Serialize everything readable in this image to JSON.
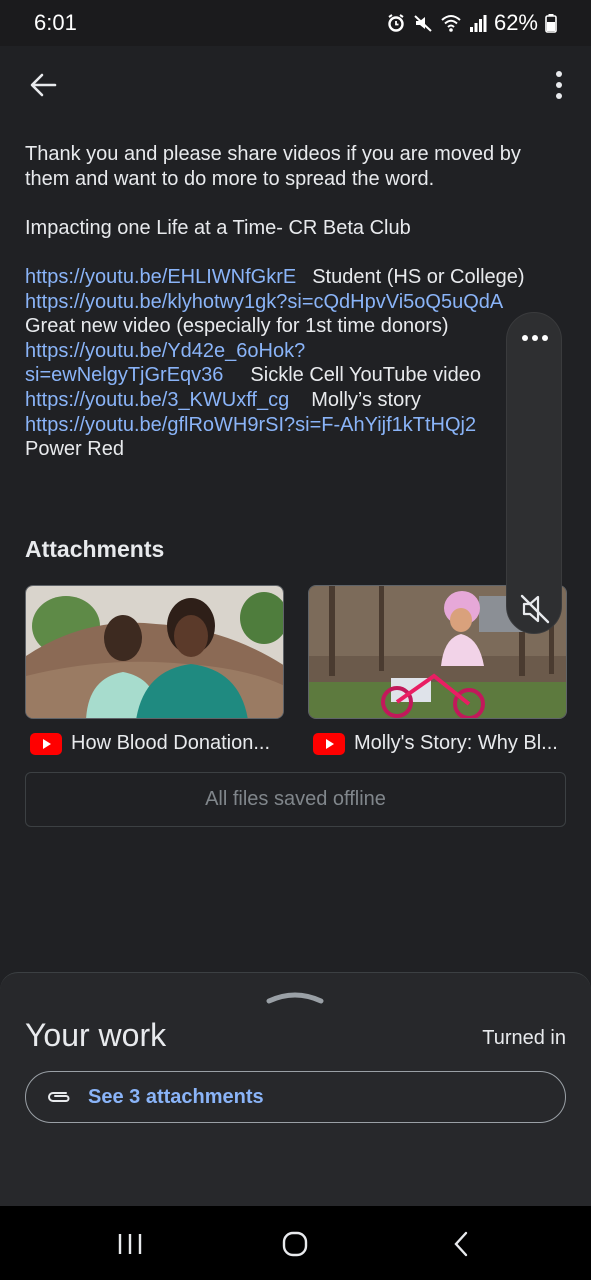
{
  "status_bar": {
    "time": "6:01",
    "battery": "62%",
    "icons": [
      "alarm-icon",
      "mute-icon",
      "wifi-icon",
      "signal-icon",
      "battery-icon"
    ]
  },
  "toolbar": {
    "back_icon": "arrow-back-icon",
    "more_icon": "more-vert-icon"
  },
  "post": {
    "intro": "Thank you and please share videos if you are moved by them and want to do more to spread the word.",
    "heading_line": "Impacting one Life at a Time- CR Beta Club",
    "links": [
      {
        "url": "https://youtu.be/EHLIWNfGkrE",
        "label": "Student (HS or College)"
      },
      {
        "url": "https://youtu.be/klyhotwy1gk?si=cQdHpvVi5oQ5uQdA",
        "label": ""
      },
      {
        "url": "",
        "label": "Great new video (especially for 1st time donors)"
      },
      {
        "url": "https://youtu.be/Yd42e_6oHok?",
        "label": ""
      },
      {
        "url": "si=ewNelgyTjGrEqv36",
        "label": "Sickle Cell YouTube video"
      },
      {
        "url": "https://youtu.be/3_KWUxff_cg",
        "label": "Molly’s story"
      },
      {
        "url": "https://youtu.be/gflRoWH9rSI?si=F-AhYijf1kTtHQj2",
        "label": ""
      },
      {
        "url": "",
        "label": "Power Red"
      }
    ]
  },
  "attachments": {
    "title": "Attachments",
    "items": [
      {
        "caption": "How Blood Donation...",
        "source_icon": "youtube-icon"
      },
      {
        "caption": "Molly's Story: Why Bl...",
        "source_icon": "youtube-icon"
      }
    ],
    "saved_status": "All files saved offline"
  },
  "overlay": {
    "menu_icon": "more-horiz-icon",
    "mute_icon": "volume-off-icon"
  },
  "your_work": {
    "title": "Your work",
    "status": "Turned in",
    "attachments_button": "See 3 attachments",
    "clip_icon": "paperclip-icon"
  },
  "nav_bar": {
    "icons": [
      "recents-icon",
      "home-icon",
      "back-nav-icon"
    ]
  },
  "colors": {
    "background": "#202124",
    "link": "#8ab4f8",
    "youtube_red": "#ff0000"
  }
}
